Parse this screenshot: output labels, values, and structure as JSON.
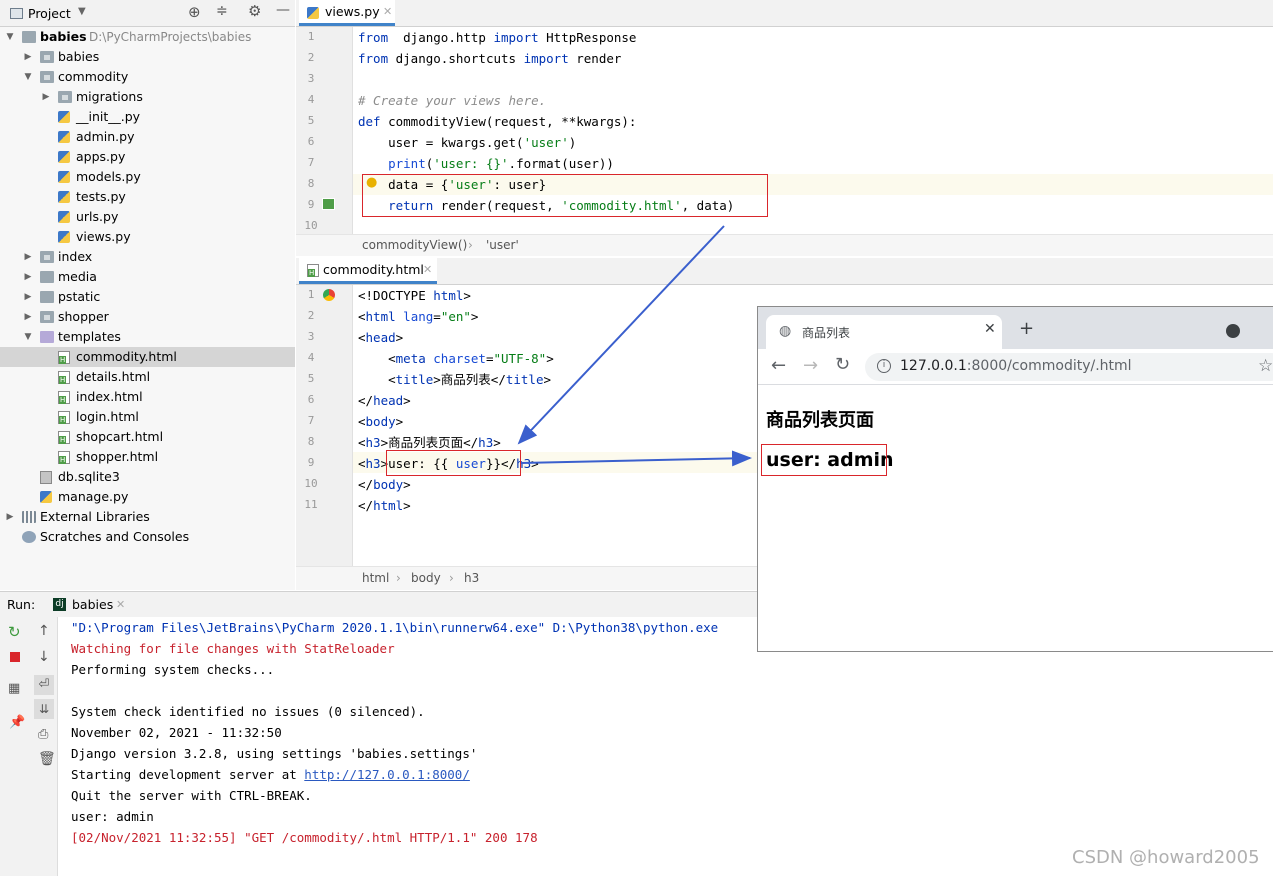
{
  "project": {
    "title": "Project"
  },
  "tree": [
    {
      "label": "babies",
      "extra": "D:\\PyCharmProjects\\babies",
      "indent": 0,
      "arrow": "down",
      "icon": "folder",
      "bold": true
    },
    {
      "label": "babies",
      "indent": 1,
      "arrow": "right",
      "icon": "folder-package"
    },
    {
      "label": "commodity",
      "indent": 1,
      "arrow": "down",
      "icon": "folder-package"
    },
    {
      "label": "migrations",
      "indent": 2,
      "arrow": "right",
      "icon": "folder-package"
    },
    {
      "label": "__init__.py",
      "indent": 2,
      "icon": "python-file"
    },
    {
      "label": "admin.py",
      "indent": 2,
      "icon": "python-file"
    },
    {
      "label": "apps.py",
      "indent": 2,
      "icon": "python-file"
    },
    {
      "label": "models.py",
      "indent": 2,
      "icon": "python-file"
    },
    {
      "label": "tests.py",
      "indent": 2,
      "icon": "python-file"
    },
    {
      "label": "urls.py",
      "indent": 2,
      "icon": "python-file"
    },
    {
      "label": "views.py",
      "indent": 2,
      "icon": "python-file"
    },
    {
      "label": "index",
      "indent": 1,
      "arrow": "right",
      "icon": "folder-package"
    },
    {
      "label": "media",
      "indent": 1,
      "arrow": "right",
      "icon": "folder"
    },
    {
      "label": "pstatic",
      "indent": 1,
      "arrow": "right",
      "icon": "folder"
    },
    {
      "label": "shopper",
      "indent": 1,
      "arrow": "right",
      "icon": "folder-package"
    },
    {
      "label": "templates",
      "indent": 1,
      "arrow": "down",
      "icon": "folder-templates"
    },
    {
      "label": "commodity.html",
      "indent": 2,
      "icon": "html-file",
      "selected": true
    },
    {
      "label": "details.html",
      "indent": 2,
      "icon": "html-file"
    },
    {
      "label": "index.html",
      "indent": 2,
      "icon": "html-file"
    },
    {
      "label": "login.html",
      "indent": 2,
      "icon": "html-file"
    },
    {
      "label": "shopcart.html",
      "indent": 2,
      "icon": "html-file"
    },
    {
      "label": "shopper.html",
      "indent": 2,
      "icon": "html-file"
    },
    {
      "label": "db.sqlite3",
      "indent": 1,
      "icon": "db-file"
    },
    {
      "label": "manage.py",
      "indent": 1,
      "icon": "python-file"
    },
    {
      "label": "External Libraries",
      "indent": 0,
      "arrow": "right",
      "icon": "library"
    },
    {
      "label": "Scratches and Consoles",
      "indent": 0,
      "icon": "scratches"
    }
  ],
  "editor1": {
    "tab": "views.py",
    "lines": [
      [
        [
          "kw",
          "from"
        ],
        [
          "",
          "  django.http "
        ],
        [
          "kw",
          "import"
        ],
        [
          "",
          " HttpResponse"
        ]
      ],
      [
        [
          "kw",
          "from"
        ],
        [
          "",
          " django.shortcuts "
        ],
        [
          "kw",
          "import"
        ],
        [
          "",
          " render"
        ]
      ],
      [],
      [
        [
          "cm",
          "# Create your views here."
        ]
      ],
      [
        [
          "kw",
          "def"
        ],
        [
          "",
          " commodityView(request, **kwargs):"
        ]
      ],
      [
        [
          "",
          "    user = kwargs.get("
        ],
        [
          "str",
          "'user'"
        ],
        [
          "",
          ")"
        ]
      ],
      [
        [
          "",
          "    "
        ],
        [
          "at",
          "print"
        ],
        [
          "",
          "("
        ],
        [
          "str",
          "'user: {}'"
        ],
        [
          "",
          ".format(user))"
        ]
      ],
      [
        [
          "",
          "    data = {"
        ],
        [
          "str",
          "'user'"
        ],
        [
          "",
          ": user}"
        ]
      ],
      [
        [
          "",
          "    "
        ],
        [
          "kw",
          "return"
        ],
        [
          "",
          " render(request, "
        ],
        [
          "str",
          "'commodity.html'"
        ],
        [
          "",
          ", data)"
        ]
      ],
      []
    ],
    "breadcrumb": [
      "commodityView()",
      "'user'"
    ]
  },
  "editor2": {
    "tab": "commodity.html",
    "lines": [
      [
        [
          "",
          "<!DOCTYPE "
        ],
        [
          "tg",
          "html"
        ],
        [
          "",
          ">"
        ]
      ],
      [
        [
          "",
          "<"
        ],
        [
          "tg",
          "html "
        ],
        [
          "at",
          "lang"
        ],
        [
          "",
          "="
        ],
        [
          "av",
          "\"en\""
        ],
        [
          "",
          ">"
        ]
      ],
      [
        [
          "",
          "<"
        ],
        [
          "tg",
          "head"
        ],
        [
          "",
          ">"
        ]
      ],
      [
        [
          "",
          "    <"
        ],
        [
          "tg",
          "meta "
        ],
        [
          "at",
          "charset"
        ],
        [
          "",
          "="
        ],
        [
          "av",
          "\"UTF-8\""
        ],
        [
          "",
          ">"
        ]
      ],
      [
        [
          "",
          "    <"
        ],
        [
          "tg",
          "title"
        ],
        [
          "",
          ">商品列表</"
        ],
        [
          "tg",
          "title"
        ],
        [
          "",
          ">"
        ]
      ],
      [
        [
          "",
          "</"
        ],
        [
          "tg",
          "head"
        ],
        [
          "",
          ">"
        ]
      ],
      [
        [
          "",
          "<"
        ],
        [
          "tg",
          "body"
        ],
        [
          "",
          ">"
        ]
      ],
      [
        [
          "",
          "<"
        ],
        [
          "tg",
          "h3"
        ],
        [
          "",
          ">商品列表页面</"
        ],
        [
          "tg",
          "h3"
        ],
        [
          "",
          ">"
        ]
      ],
      [
        [
          "",
          "<"
        ],
        [
          "tg",
          "h3"
        ],
        [
          "",
          ">user: {{ "
        ],
        [
          "at",
          "user"
        ],
        [
          "",
          ""
        ],
        [
          "",
          "}}</"
        ],
        [
          "tg",
          "h3"
        ],
        [
          "",
          ">"
        ]
      ],
      [
        [
          "",
          "</"
        ],
        [
          "tg",
          "body"
        ],
        [
          "",
          ">"
        ]
      ],
      [
        [
          "",
          "</"
        ],
        [
          "tg",
          "html"
        ],
        [
          "",
          ">"
        ]
      ]
    ],
    "breadcrumb": [
      "html",
      "body",
      "h3"
    ]
  },
  "run": {
    "label": "Run:",
    "tab": "babies",
    "lines": [
      {
        "t": "\"D:\\Program Files\\JetBrains\\PyCharm 2020.1.1\\bin\\runnerw64.exe\" D:\\Python38\\python.exe",
        "c": "#0033b3"
      },
      {
        "t": "Watching for file changes with StatReloader",
        "c": "#c7222d"
      },
      {
        "t": "Performing system checks...",
        "c": "#000"
      },
      {
        "t": "",
        "c": "#000"
      },
      {
        "t": "System check identified no issues (0 silenced).",
        "c": "#000"
      },
      {
        "t": "November 02, 2021 - 11:32:50",
        "c": "#000"
      },
      {
        "t": "Django version 3.2.8, using settings 'babies.settings'",
        "c": "#000"
      },
      {
        "t": "Starting development server at ",
        "c": "#000",
        "link": "http://127.0.0.1:8000/"
      },
      {
        "t": "Quit the server with CTRL-BREAK.",
        "c": "#000"
      },
      {
        "t": "user: admin",
        "c": "#000"
      },
      {
        "t": "[02/Nov/2021 11:32:55] \"GET /commodity/.html HTTP/1.1\" 200 178",
        "c": "#c7222d"
      }
    ]
  },
  "browser": {
    "tab": "商品列表",
    "url_host": "127.0.0.1",
    "url_rest": ":8000/commodity/.html",
    "heading": "商品列表页面",
    "user_line": "user: admin"
  },
  "watermark": "CSDN @howard2005",
  "colors": {
    "accent": "#4083c9",
    "highlight": "#d9262b",
    "arrow": "#3a5fcd"
  }
}
